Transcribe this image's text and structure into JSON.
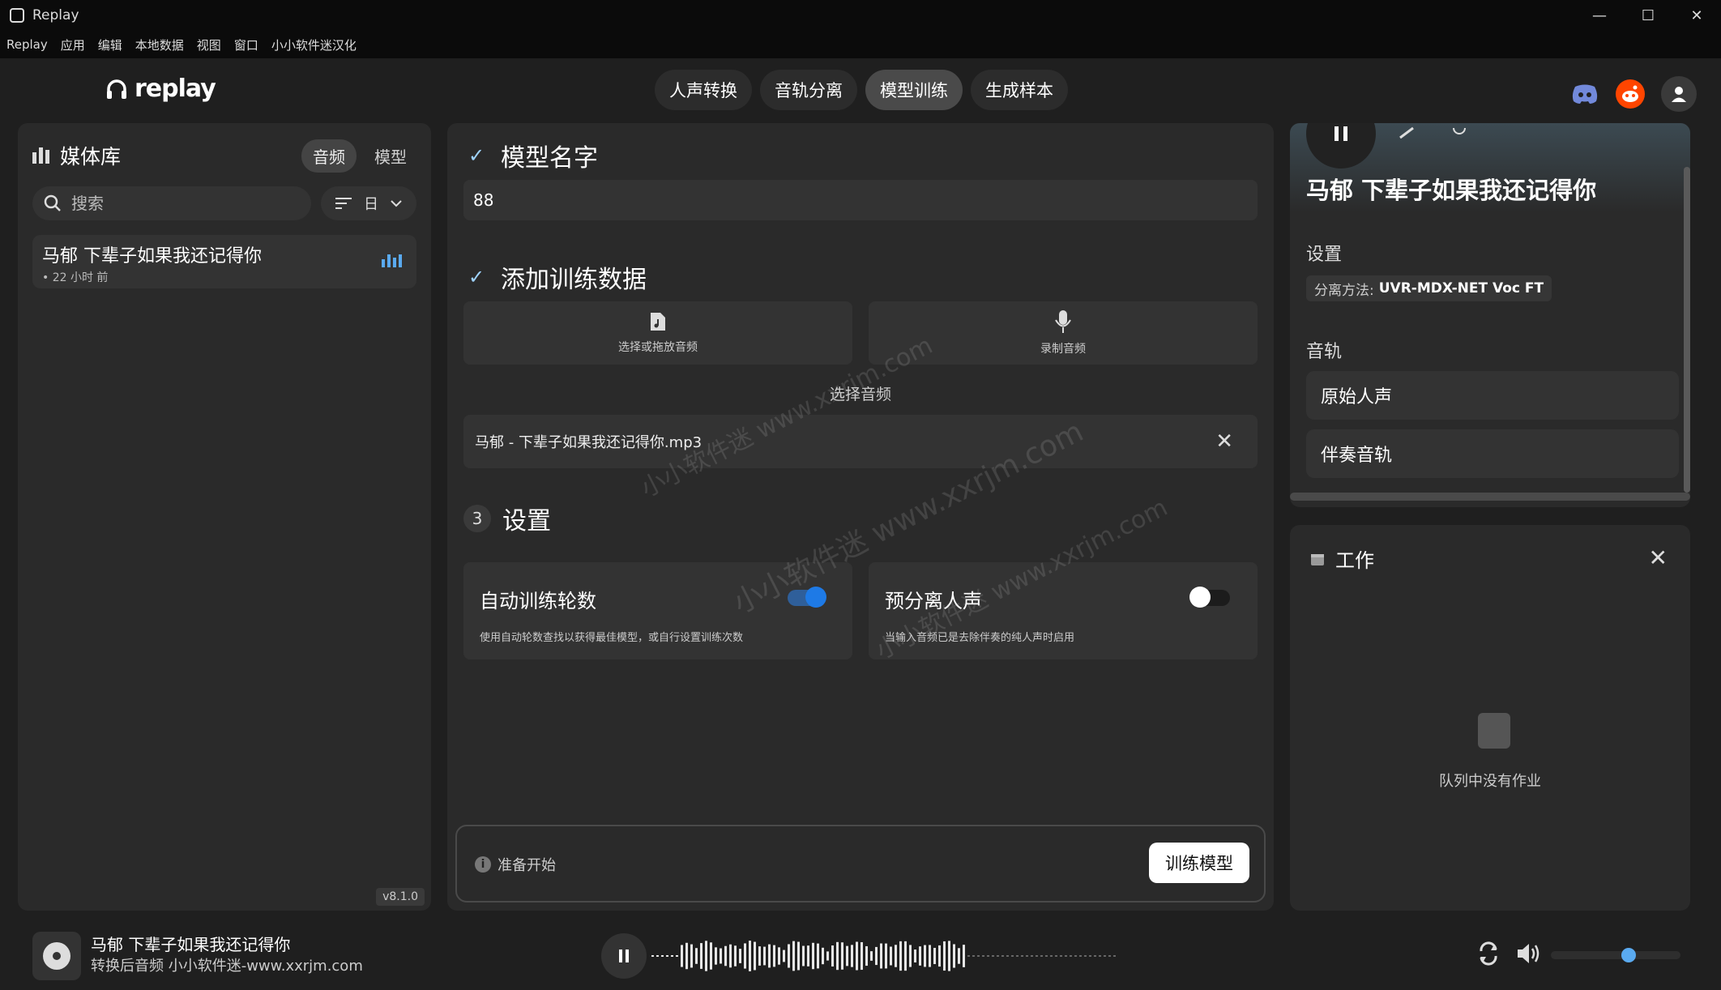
{
  "window": {
    "title": "Replay",
    "controls": [
      "—",
      "☐",
      "✕"
    ]
  },
  "menu": [
    "Replay",
    "应用",
    "编辑",
    "本地数据",
    "视图",
    "窗口",
    "小小软件迷汉化"
  ],
  "logo": {
    "text": "replay"
  },
  "nav": {
    "tabs": [
      {
        "label": "人声转换",
        "active": false
      },
      {
        "label": "音轨分离",
        "active": false
      },
      {
        "label": "模型训练",
        "active": true
      },
      {
        "label": "生成样本",
        "active": false
      }
    ]
  },
  "library": {
    "title": "媒体库",
    "tabs": [
      "音频",
      "模型"
    ],
    "search_placeholder": "搜索",
    "sort_label": "日",
    "items": [
      {
        "title": "马郁 下辈子如果我还记得你",
        "subtitle": "• 22 小时 前"
      }
    ],
    "version": "v8.1.0"
  },
  "training": {
    "name_section": "模型名字",
    "name_value": "88",
    "data_section": "添加训练数据",
    "drop_label": "选择或拖放音频",
    "record_label": "录制音频",
    "file_caption": "选择音频",
    "file_name": "马郁 - 下辈子如果我还记得你.mp3",
    "settings_number": "3",
    "settings_section": "设置",
    "option1": {
      "title": "自动训练轮数",
      "desc": "使用自动轮数查找以获得最佳模型，或自行设置训练次数",
      "enabled": true
    },
    "option2": {
      "title": "预分离人声",
      "desc": "当输入音频已是去除伴奏的纯人声时启用",
      "enabled": false
    },
    "status": "准备开始",
    "train_button": "训练模型"
  },
  "detail": {
    "song_title": "马郁 下辈子如果我还记得你",
    "settings_label": "设置",
    "method_label": "分离方法:",
    "method_value": "UVR-MDX-NET Voc FT",
    "tracks_label": "音轨",
    "tracks": [
      "原始人声",
      "伴奏音轨"
    ]
  },
  "jobs": {
    "title": "工作",
    "empty": "队列中没有作业"
  },
  "player": {
    "title": "马郁 下辈子如果我还记得你",
    "subtitle": "转换后音频 小小软件迷-www.xxrjm.com",
    "volume": 0.6
  },
  "watermarks": [
    "小小软件迷 www.xxrjm.com",
    "小小软件迷 www.xxrjm.com",
    "小小软件迷 www.xxrjm.com"
  ],
  "colors": {
    "accent": "#5aaaf0",
    "panel": "#2a2a2a",
    "background": "#1f1f1f",
    "check": "#9fd3ff"
  }
}
